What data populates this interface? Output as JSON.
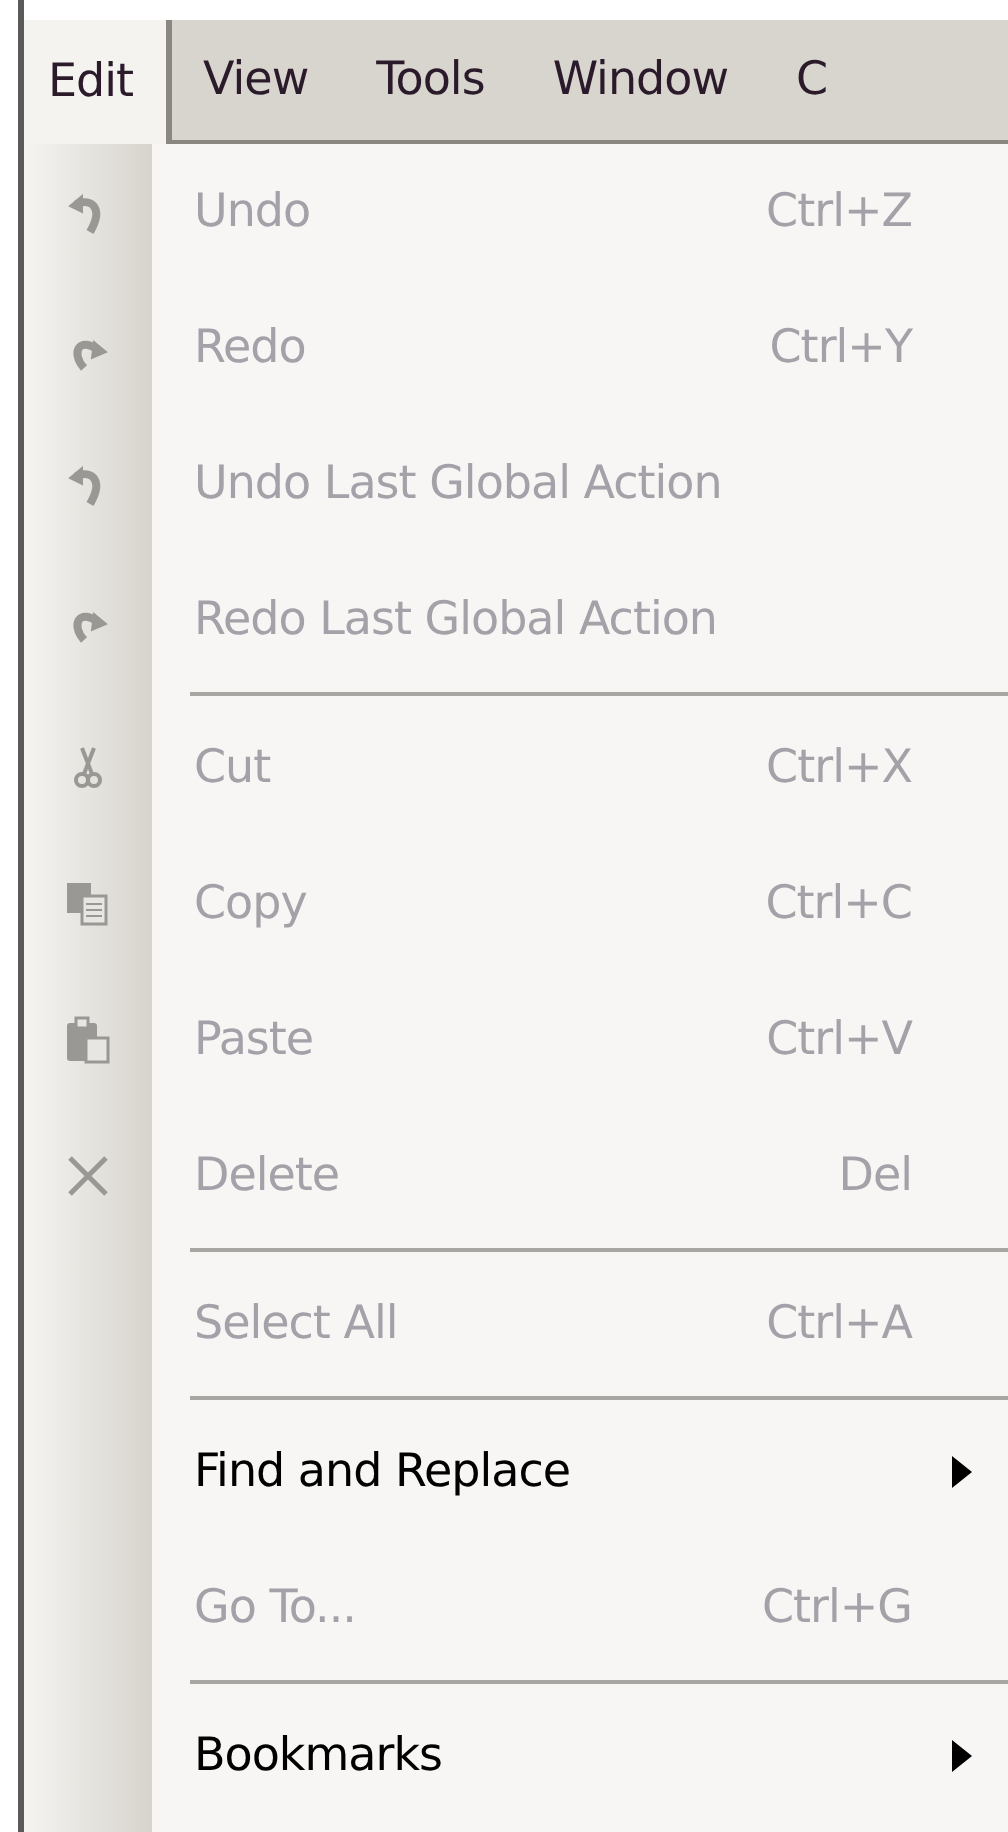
{
  "menubar": [
    {
      "label": "Edit",
      "selected": true
    },
    {
      "label": "View",
      "selected": false
    },
    {
      "label": "Tools",
      "selected": false
    },
    {
      "label": "Window",
      "selected": false
    },
    {
      "label": "C",
      "selected": false
    }
  ],
  "menu": [
    {
      "kind": "command",
      "label": "Undo",
      "shortcut": "Ctrl+Z",
      "disabled": true
    },
    {
      "kind": "command",
      "label": "Redo",
      "shortcut": "Ctrl+Y",
      "disabled": true
    },
    {
      "kind": "command",
      "label": "Undo Last Global Action",
      "disabled": true
    },
    {
      "kind": "command",
      "label": "Redo Last Global Action",
      "disabled": true
    },
    {
      "kind": "separator"
    },
    {
      "kind": "command",
      "label": "Cut",
      "shortcut": "Ctrl+X",
      "disabled": true
    },
    {
      "kind": "command",
      "label": "Copy",
      "shortcut": "Ctrl+C",
      "disabled": true
    },
    {
      "kind": "command",
      "label": "Paste",
      "shortcut": "Ctrl+V",
      "disabled": true
    },
    {
      "kind": "command",
      "label": "Delete",
      "shortcut": "Del",
      "disabled": true
    },
    {
      "kind": "separator"
    },
    {
      "kind": "command",
      "label": "Select All",
      "shortcut": "Ctrl+A",
      "disabled": true
    },
    {
      "kind": "separator"
    },
    {
      "kind": "submenu",
      "label": "Find and Replace",
      "disabled": false
    },
    {
      "kind": "command",
      "label": "Go To...",
      "shortcut": "Ctrl+G",
      "disabled": true
    },
    {
      "kind": "separator"
    },
    {
      "kind": "submenu",
      "label": "Bookmarks",
      "disabled": false
    }
  ]
}
